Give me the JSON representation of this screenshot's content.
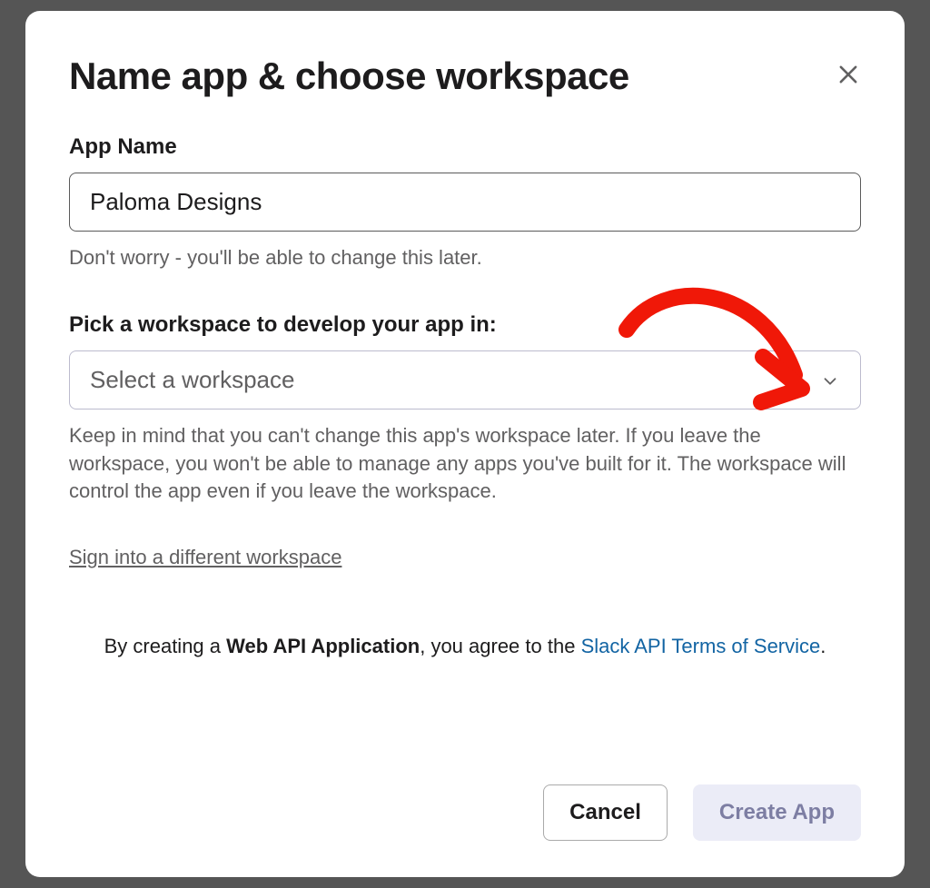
{
  "modal": {
    "title": "Name app & choose workspace",
    "close_icon": "close-icon"
  },
  "app_name": {
    "label": "App Name",
    "value": "Paloma Designs",
    "hint": "Don't worry - you'll be able to change this later."
  },
  "workspace": {
    "label": "Pick a workspace to develop your app in:",
    "placeholder": "Select a workspace",
    "hint": "Keep in mind that you can't change this app's workspace later. If you leave the workspace, you won't be able to manage any apps you've built for it. The workspace will control the app even if you leave the workspace.",
    "signin_link": "Sign into a different workspace"
  },
  "terms": {
    "prefix": "By creating a ",
    "bold": "Web API Application",
    "middle": ", you agree to the ",
    "link": "Slack API Terms of Service",
    "suffix": "."
  },
  "footer": {
    "cancel_label": "Cancel",
    "create_label": "Create App"
  },
  "annotation": {
    "type": "hand-drawn-arrow",
    "color": "#f01808"
  }
}
